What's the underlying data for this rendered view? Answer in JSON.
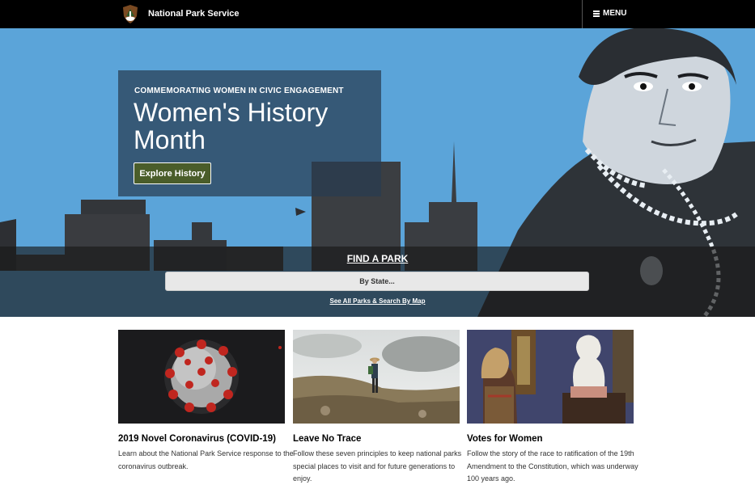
{
  "header": {
    "brand": "National Park Service",
    "menu_label": "MENU",
    "logo_icon": "nps-arrowhead-icon",
    "menu_icon": "hamburger-icon"
  },
  "hero": {
    "kicker": "COMMEMORATING WOMEN IN CIVIC ENGAGEMENT",
    "title": "Women's History Month",
    "button_label": "Explore History"
  },
  "find_park": {
    "title": "FIND A PARK",
    "select_value": "By State...",
    "map_link": "See All Parks & Search By Map"
  },
  "cards": [
    {
      "title": "2019 Novel Coronavirus (COVID-19)",
      "text": "Learn about the National Park Service response to the coronavirus outbreak."
    },
    {
      "title": "Leave No Trace",
      "text": "Follow these seven principles to keep national parks special places to visit and for future generations to enjoy."
    },
    {
      "title": "Votes for Women",
      "text": "Follow the story of the race to ratification of the 19th Amendment to the Constitution, which was underway 100 years ago."
    }
  ],
  "colors": {
    "topbar": "#000000",
    "button": "#4a5d2a",
    "sky": "#5ba4d9"
  }
}
